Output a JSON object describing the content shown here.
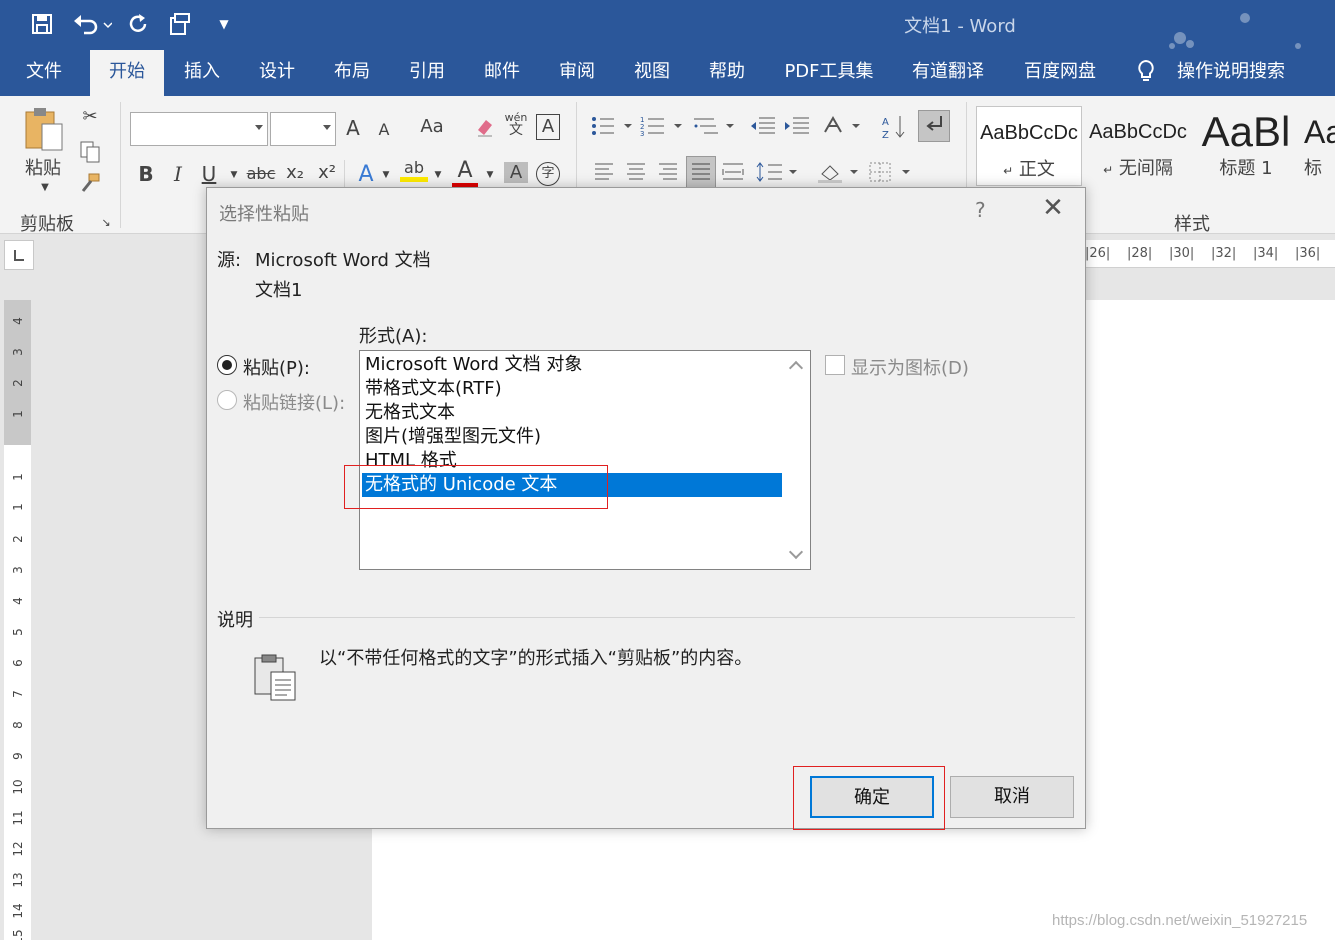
{
  "window": {
    "title": "文档1  -  Word"
  },
  "quick_access": {
    "icons": [
      "save-icon",
      "undo-icon",
      "redo-icon",
      "format-painter-icon",
      "customize-icon"
    ]
  },
  "ribbon_tabs": [
    {
      "label": "文件"
    },
    {
      "label": "开始",
      "active": true
    },
    {
      "label": "插入"
    },
    {
      "label": "设计"
    },
    {
      "label": "布局"
    },
    {
      "label": "引用"
    },
    {
      "label": "邮件"
    },
    {
      "label": "审阅"
    },
    {
      "label": "视图"
    },
    {
      "label": "帮助"
    },
    {
      "label": "PDF工具集"
    },
    {
      "label": "有道翻译"
    },
    {
      "label": "百度网盘"
    }
  ],
  "tell_me": {
    "label": "操作说明搜索"
  },
  "ribbon": {
    "clipboard": {
      "paste_label": "粘贴",
      "group_label": "剪贴板"
    },
    "font": {
      "bold": "B",
      "italic": "I",
      "underline": "U",
      "strike": "abc",
      "subscript": "x₂",
      "superscript": "x²",
      "grow": "A",
      "shrink": "A",
      "case": "Aa",
      "phonetic_top": "wén",
      "phonetic_bottom": "文",
      "border_char": "A",
      "effects": "A",
      "highlight": "ab",
      "color": "A",
      "shade": "A",
      "enclose": "字"
    },
    "styles": {
      "group_label": "样式",
      "items": [
        {
          "sample": "AaBbCcDc",
          "name": "正文",
          "mark": "↵"
        },
        {
          "sample": "AaBbCcDc",
          "name": "无间隔",
          "mark": "↵"
        },
        {
          "sample": "AaBl",
          "name": "标题 1"
        },
        {
          "sample": "Aa",
          "name": "标"
        }
      ]
    }
  },
  "ruler": {
    "h_ticks": [
      "|26|",
      "|28|",
      "|30|",
      "|32|",
      "|34|",
      "|36|"
    ],
    "v_numbers": [
      "4",
      "3",
      "2",
      "1",
      "1",
      "1",
      "2",
      "3",
      "4",
      "5",
      "6",
      "7",
      "8",
      "9",
      "10",
      "11",
      "12",
      "13",
      "14",
      "15"
    ]
  },
  "dialog": {
    "title": "选择性粘贴",
    "help": "?",
    "close": "✕",
    "source_label": "源:",
    "source_value": "Microsoft Word 文档",
    "source_doc": "文档1",
    "format_label": "形式(A):",
    "paste_option": "粘贴(P):",
    "paste_link_option": "粘贴链接(L):",
    "formats": [
      "Microsoft Word 文档 对象",
      "带格式文本(RTF)",
      "无格式文本",
      "图片(增强型图元文件)",
      "HTML 格式",
      "无格式的 Unicode 文本"
    ],
    "selected_index": 5,
    "display_as_icon": "显示为图标(D)",
    "desc_label": "说明",
    "desc_text": "以“不带任何格式的文字”的形式插入“剪贴板”的内容。",
    "ok": "确定",
    "cancel": "取消"
  },
  "watermark": "https://blog.csdn.net/weixin_51927215",
  "colors": {
    "brand": "#2b579a",
    "selection": "#0078d7",
    "highlight_box": "#e02020"
  }
}
